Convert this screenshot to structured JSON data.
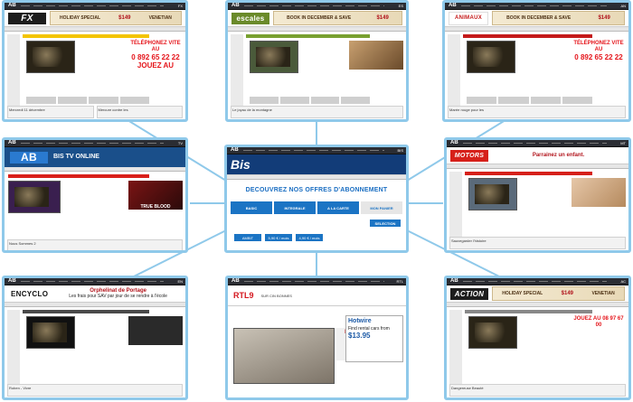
{
  "connectors": {
    "color": "#8fc9ea"
  },
  "tiles": {
    "fx": {
      "logo_text": "FX",
      "logo_bg": "#1d1d1d",
      "ad": {
        "headline": "HOLIDAY SPECIAL",
        "price": "$149",
        "brand": "VENETIAN"
      },
      "phone_top": "TÉLÉPHONEZ VITE AU",
      "phone_number": "0 892 65 22 22",
      "phone_bottom": "JOUEZ AU",
      "footer_left": "Mercredi 11 décembre",
      "footer_mid": "Mercure contre les",
      "bar_color": "#f3c400"
    },
    "escales": {
      "logo_text": "escales",
      "logo_bg": "#6a8a2a",
      "ad": {
        "headline": "BOOK IN DECEMBER & SAVE",
        "price": "$149",
        "brand": "VENETIAN"
      },
      "footer_mid": "Le joyau de la montagne",
      "bar_color": "#78a030"
    },
    "animaux": {
      "logo_text": "ANIMAUX",
      "logo_bg": "#ffffff",
      "ad": {
        "headline": "BOOK IN DECEMBER & SAVE",
        "price": "$149",
        "brand": "VENETIAN"
      },
      "phone_top": "TÉLÉPHONEZ VITE AU",
      "phone_number": "0 892 65 22 22",
      "footer_mid": "Marée rouge pour les",
      "bar_color": "#c41a1a"
    },
    "abtv": {
      "logo_text": "AB",
      "channel_text": "BIS TV ONLINE",
      "footer_mid": "Nous Sommes 2",
      "promo": "TRUE BLOOD",
      "bar_color": "#d9201a"
    },
    "bis_center": {
      "logo_text": "Bis",
      "headline": "DECOUVREZ NOS OFFRES D'ABONNEMENT",
      "offers": [
        "BASIC",
        "INTEGRALE",
        "A LA CARTE",
        "MON PANIER"
      ],
      "select_label": "SELECTION",
      "bottom_buttons": [
        "AMBIT",
        "5,90 € / mois",
        "4,90 € / mois"
      ]
    },
    "motors": {
      "logo_text": "MOTORS",
      "logo_bg": "#d6201a",
      "ad_text": "Parrainez un enfant.",
      "footer_mid": "Sauvegarder l'histoire",
      "bar_color": "#d6201a"
    },
    "encyclo": {
      "logo_text": "ENCYCLO",
      "ad_title": "Orphelinat de Portage",
      "ad_line": "Les frais pour SAV par jour de se rendre à l'école",
      "footer_mid": "Roben - Vivre",
      "bar_color": "#4a4a4a"
    },
    "rtl": {
      "logo_text": "RTL9",
      "section": "SUR CIN BONNES",
      "bonnes_text": "BONNES FÊTES",
      "hotwire": "Hotwire",
      "hot_line": "Find rental cars from",
      "hot_price": "$13.95",
      "bar_color": "#d4161e"
    },
    "action": {
      "logo_text": "ACTION",
      "logo_bg": "#1d1d1d",
      "ad": {
        "headline": "HOLIDAY SPECIAL",
        "price": "$149",
        "brand": "VENETIAN"
      },
      "phone_number": "JOUEZ AU 08 97 67 00",
      "footer_mid": "Dangereuse Beauté",
      "bar_color": "#888888"
    }
  }
}
